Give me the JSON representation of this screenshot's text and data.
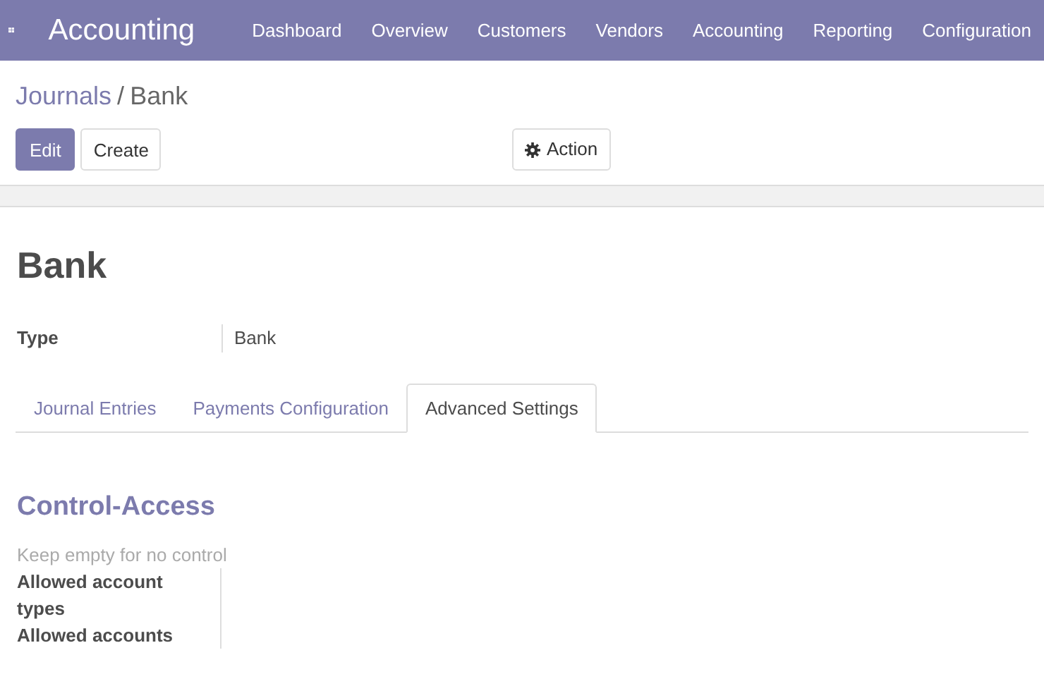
{
  "app": {
    "title": "Accounting"
  },
  "menu": [
    "Dashboard",
    "Overview",
    "Customers",
    "Vendors",
    "Accounting",
    "Reporting",
    "Configuration"
  ],
  "breadcrumb": [
    {
      "label": "Journals",
      "kind": "link"
    },
    {
      "label": "/",
      "kind": "separator"
    },
    {
      "label": "Bank",
      "kind": "current"
    }
  ],
  "buttons": [
    {
      "label": "Edit",
      "kind": "primary"
    },
    {
      "label": "Create",
      "kind": "secondary"
    }
  ],
  "action": {
    "label": "Action"
  },
  "record": {
    "title": "Bank",
    "fields": [
      {
        "label": "Type",
        "value": "Bank"
      }
    ]
  },
  "tabs": [
    {
      "label": "Journal Entries",
      "selected": false
    },
    {
      "label": "Payments Configuration",
      "selected": false
    },
    {
      "label": "Advanced Settings",
      "selected": true
    }
  ],
  "section": {
    "title": "Control-Access",
    "hint": "Keep empty for no control",
    "fields": [
      "Allowed account types",
      "Allowed accounts"
    ]
  }
}
